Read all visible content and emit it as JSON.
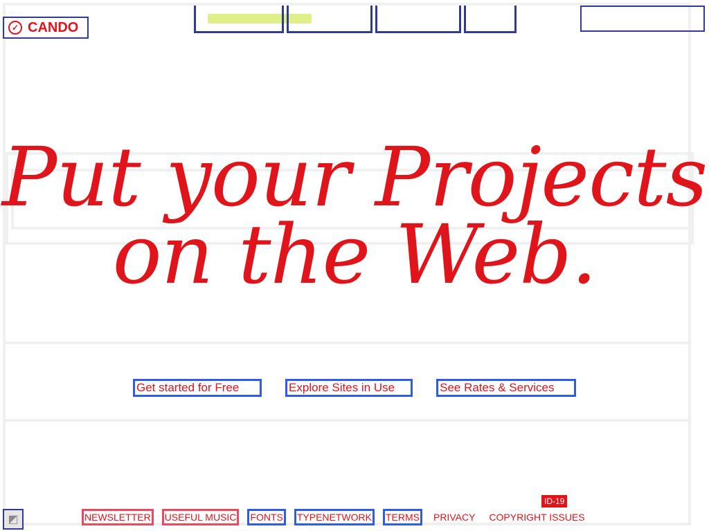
{
  "brand": {
    "logo_text": "CANDO",
    "logo_mark": "✓"
  },
  "hero": {
    "line1": "Put your Projects",
    "line2": "on the Web."
  },
  "cta": {
    "get_started": "Get started for Free",
    "explore": "Explore Sites in Use",
    "rates": "See Rates & Services"
  },
  "footer": {
    "badge": "ID-19",
    "links": {
      "newsletter": "NEWSLETTER",
      "useful_music": "USEFUL MUSIC",
      "fonts": "FONTS",
      "typenetwork": "TYPENETWORK",
      "terms": "TERMS",
      "privacy": "PRIVACY",
      "copyright": "COPYRIGHT ISSUES"
    },
    "icon_glyph": "◩"
  },
  "colors": {
    "accent": "#e0141b",
    "background": "#ffffff",
    "highlight": "#dff08a"
  }
}
